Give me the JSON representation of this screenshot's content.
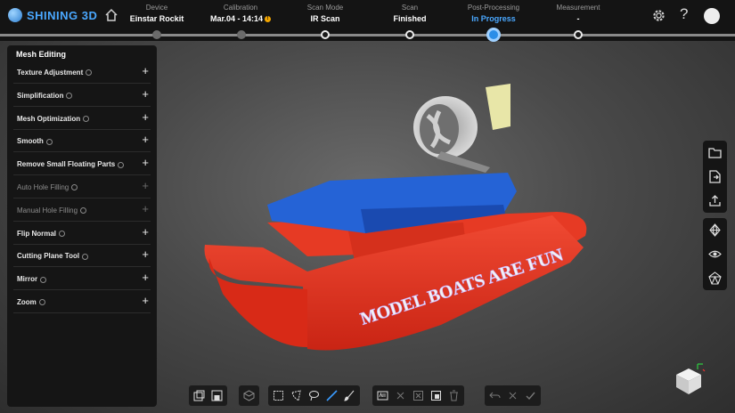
{
  "app": {
    "brand": "SHINING 3D"
  },
  "steps": [
    {
      "label": "Device",
      "value": "Einstar Rockit"
    },
    {
      "label": "Calibration",
      "value": "Mar.04 - 14:14"
    },
    {
      "label": "Scan Mode",
      "value": "IR Scan"
    },
    {
      "label": "Scan",
      "value": "Finished"
    },
    {
      "label": "Post-Processing",
      "value": "In Progress"
    },
    {
      "label": "Measurement",
      "value": "-"
    }
  ],
  "panel": {
    "title": "Mesh Editing",
    "items": [
      {
        "label": "Texture Adjustment",
        "enabled": true
      },
      {
        "label": "Simplification",
        "enabled": true
      },
      {
        "label": "Mesh Optimization",
        "enabled": true
      },
      {
        "label": "Smooth",
        "enabled": true
      },
      {
        "label": "Remove Small Floating Parts",
        "enabled": true
      },
      {
        "label": "Auto Hole Filling",
        "enabled": false
      },
      {
        "label": "Manual Hole Filling",
        "enabled": false
      },
      {
        "label": "Flip Normal",
        "enabled": true
      },
      {
        "label": "Cutting Plane Tool",
        "enabled": true
      },
      {
        "label": "Mirror",
        "enabled": true
      },
      {
        "label": "Zoom",
        "enabled": true
      }
    ],
    "plus": "+"
  },
  "model": {
    "text": "MODEL BOATS ARE FUN"
  },
  "colors": {
    "accent": "#4aa8ff",
    "active_dot": "#2b8ee8",
    "hull": "#e8321e",
    "deck": "#1f5fd0"
  },
  "right_toolbar": [
    "folder-icon",
    "export-icon",
    "upload-icon",
    "mesh-view-icon",
    "eye-icon",
    "texture-view-icon"
  ],
  "bottom_toolbar": {
    "group1": [
      "import-icon",
      "save-icon"
    ],
    "group2": [
      "view-icon"
    ],
    "group3": [
      "rect-select-icon",
      "polygon-select-icon",
      "lasso-select-icon",
      "line-select-icon",
      "brush-select-icon"
    ],
    "group4": [
      "select-all-icon",
      "clear-icon",
      "invert-icon",
      "select-connected-icon",
      "delete-icon"
    ],
    "group5": [
      "undo-icon",
      "redo-icon",
      "apply-icon"
    ]
  }
}
